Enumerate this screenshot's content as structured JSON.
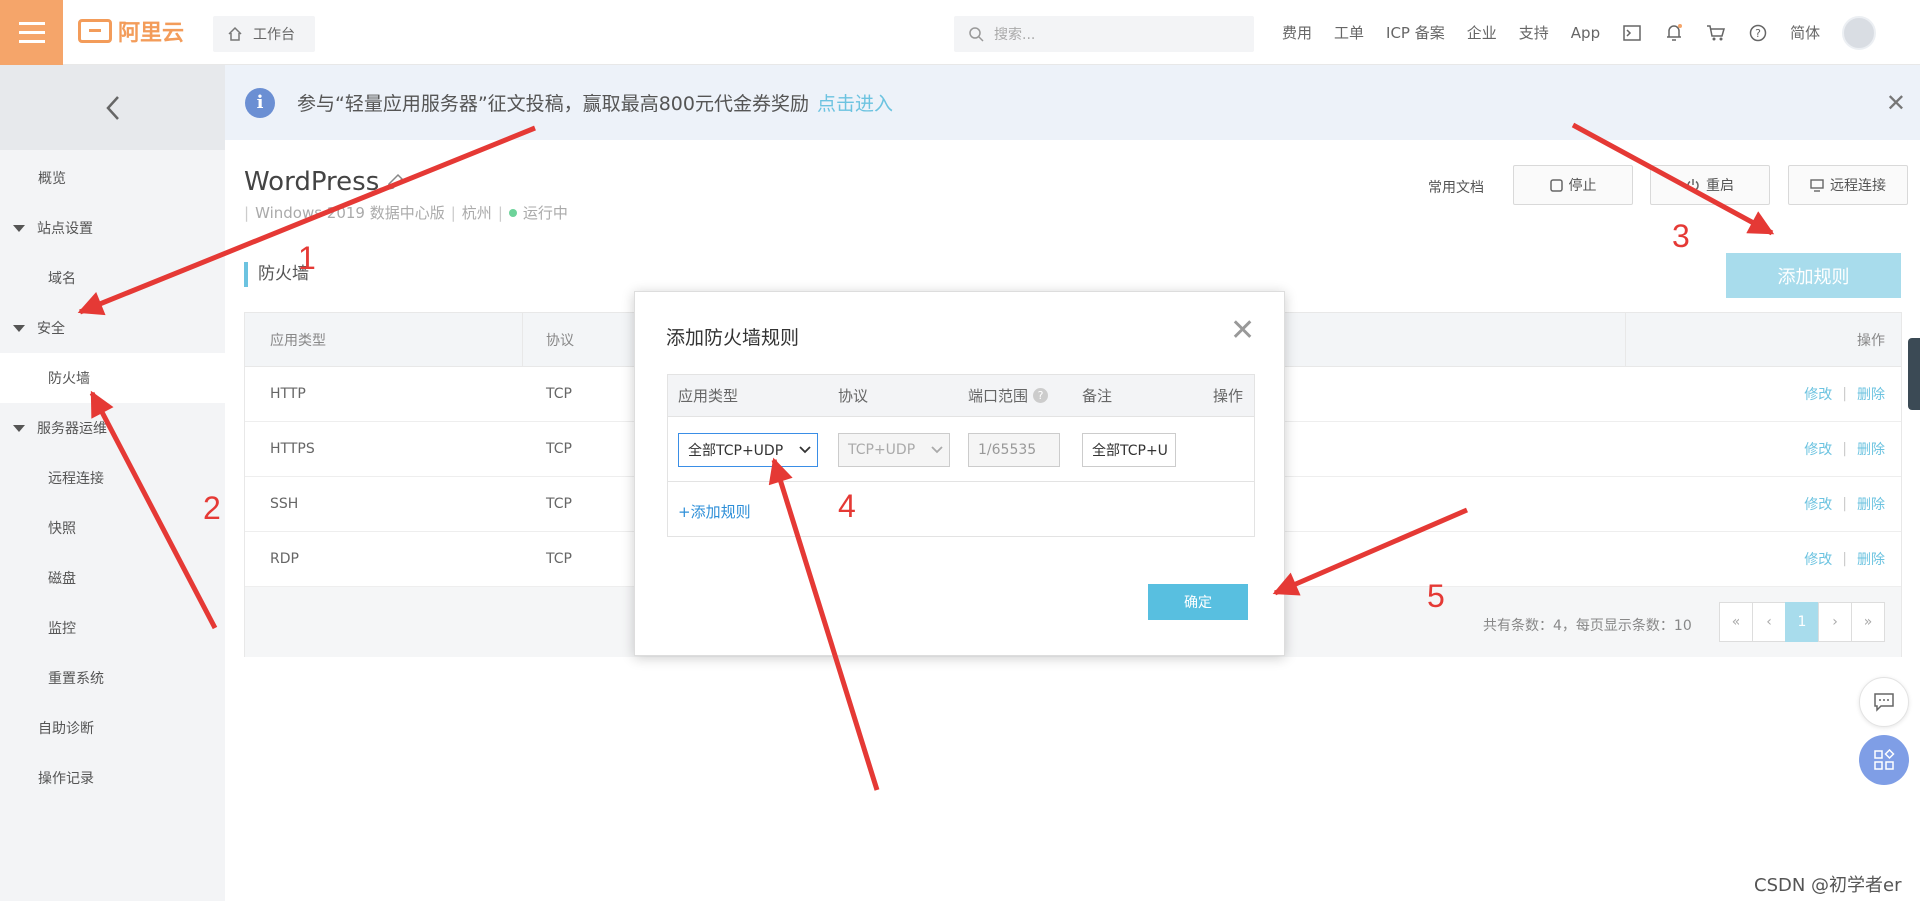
{
  "topbar": {
    "logo_text": "阿里云",
    "workbench_label": "工作台",
    "search_placeholder": "搜索...",
    "nav": [
      "费用",
      "工单",
      "ICP 备案",
      "企业",
      "支持",
      "App"
    ],
    "lang": "简体"
  },
  "sidebar": {
    "items": [
      {
        "label": "概览"
      },
      {
        "label": "站点设置"
      },
      {
        "label": "域名"
      },
      {
        "label": "安全"
      },
      {
        "label": "防火墙"
      },
      {
        "label": "服务器运维"
      },
      {
        "label": "远程连接"
      },
      {
        "label": "快照"
      },
      {
        "label": "磁盘"
      },
      {
        "label": "监控"
      },
      {
        "label": "重置系统"
      },
      {
        "label": "自助诊断"
      },
      {
        "label": "操作记录"
      }
    ]
  },
  "banner": {
    "text": "参与“轻量应用服务器”征文投稿，赢取最高800元代金券奖励",
    "link": "点击进入"
  },
  "header": {
    "title": "WordPress",
    "os": "Windows 2019 数据中心版",
    "region": "杭州",
    "status": "运行中",
    "doc_link": "常用文档",
    "stop_label": "停止",
    "restart_label": "重启",
    "remote_label": "远程连接"
  },
  "firewall": {
    "section_title": "防火墙",
    "add_rule_label": "添加规则",
    "columns": {
      "app_type": "应用类型",
      "protocol": "协议",
      "action": "操作"
    },
    "rows": [
      {
        "app": "HTTP",
        "protocol": "TCP"
      },
      {
        "app": "HTTPS",
        "protocol": "TCP"
      },
      {
        "app": "SSH",
        "protocol": "TCP"
      },
      {
        "app": "RDP",
        "protocol": "TCP"
      }
    ],
    "edit_label": "修改",
    "delete_label": "删除",
    "pager_text": "共有条数：4，每页显示条数：10",
    "current_page": "1"
  },
  "modal": {
    "title": "添加防火墙规则",
    "columns": {
      "app_type": "应用类型",
      "protocol": "协议",
      "port_range": "端口范围",
      "note": "备注",
      "action": "操作"
    },
    "app_type_value": "全部TCP+UDP",
    "protocol_value": "TCP+UDP",
    "port_value": "1/65535",
    "note_value": "全部TCP+U",
    "add_link": "+添加规则",
    "ok_label": "确定"
  },
  "annotations": [
    "1",
    "2",
    "3",
    "4",
    "5"
  ],
  "watermark": "CSDN @初学者er",
  "colors": {
    "brand": "#f5a56a",
    "accent": "#6cc3e0",
    "arrow": "#e53935",
    "ok_button": "#58bfe0"
  }
}
